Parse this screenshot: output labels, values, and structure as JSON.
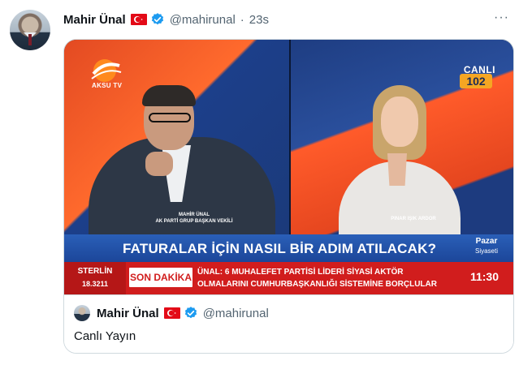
{
  "tweet": {
    "author_name": "Mahir Ünal",
    "handle": "@mahirunal",
    "time_sep": "·",
    "time": "23s",
    "more_label": "···"
  },
  "video": {
    "channel_logo": "AKSU TV",
    "live_label": "CANLI",
    "channel_number": "102",
    "guest_caption_line1": "MAHİR ÜNAL",
    "guest_caption_line2": "AK PARTİ GRUP BAŞKAN VEKİLİ",
    "host_caption": "PINAR IŞIK ARDOR",
    "headline": "FATURALAR İÇİN NASIL BİR ADIM ATILACAK?",
    "program_day": "Pazar",
    "program_name": "Siyaseti",
    "currency_name": "STERLİN",
    "currency_value": "18.3211",
    "breaking_label": "SON DAKİKA",
    "ticker_line1": "ÜNAL: 6 MUHALEFET PARTİSİ LİDERİ SİYASİ AKTÖR",
    "ticker_line2": "OLMALARINI CUMHURBAŞKANLIĞI SİSTEMİNE BORÇLULAR",
    "clock": "11:30"
  },
  "quoted": {
    "author_name": "Mahir Ünal",
    "handle": "@mahirunal",
    "text": "Canlı Yayın"
  },
  "colors": {
    "verified_blue": "#1d9bf0",
    "flag_red": "#e30a17",
    "ticker_red": "#d11d1d",
    "headline_blue": "#1c4699"
  }
}
